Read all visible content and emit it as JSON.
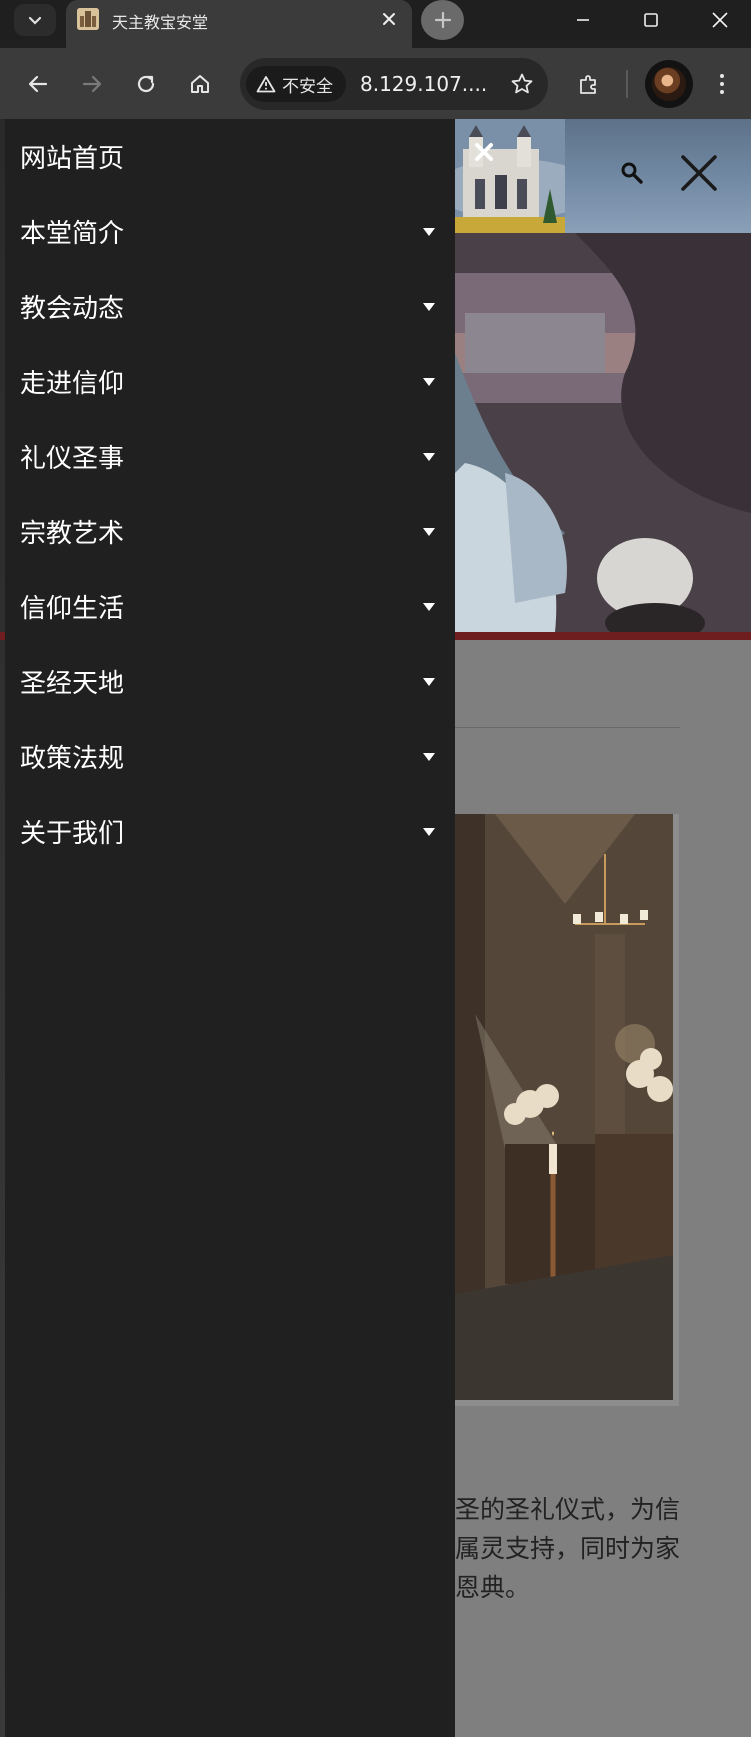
{
  "browser": {
    "tab_title": "天主教宝安堂",
    "security_label": "不安全",
    "url": "8.129.107...."
  },
  "drawer": {
    "items": [
      {
        "label": "网站首页",
        "has_submenu": false
      },
      {
        "label": "本堂简介",
        "has_submenu": true
      },
      {
        "label": "教会动态",
        "has_submenu": true
      },
      {
        "label": "走进信仰",
        "has_submenu": true
      },
      {
        "label": "礼仪圣事",
        "has_submenu": true
      },
      {
        "label": "宗教艺术",
        "has_submenu": true
      },
      {
        "label": "信仰生活",
        "has_submenu": true
      },
      {
        "label": "圣经天地",
        "has_submenu": true
      },
      {
        "label": "政策法规",
        "has_submenu": true
      },
      {
        "label": "关于我们",
        "has_submenu": true
      }
    ]
  },
  "article": {
    "lines": [
      "圣的圣礼仪式，为信",
      "属灵支持，同时为家",
      "恩典。"
    ]
  },
  "colors": {
    "drawer_bg": "#202020",
    "overlay": "#7f7f7f",
    "accent_strip": "#6e1e1e"
  }
}
